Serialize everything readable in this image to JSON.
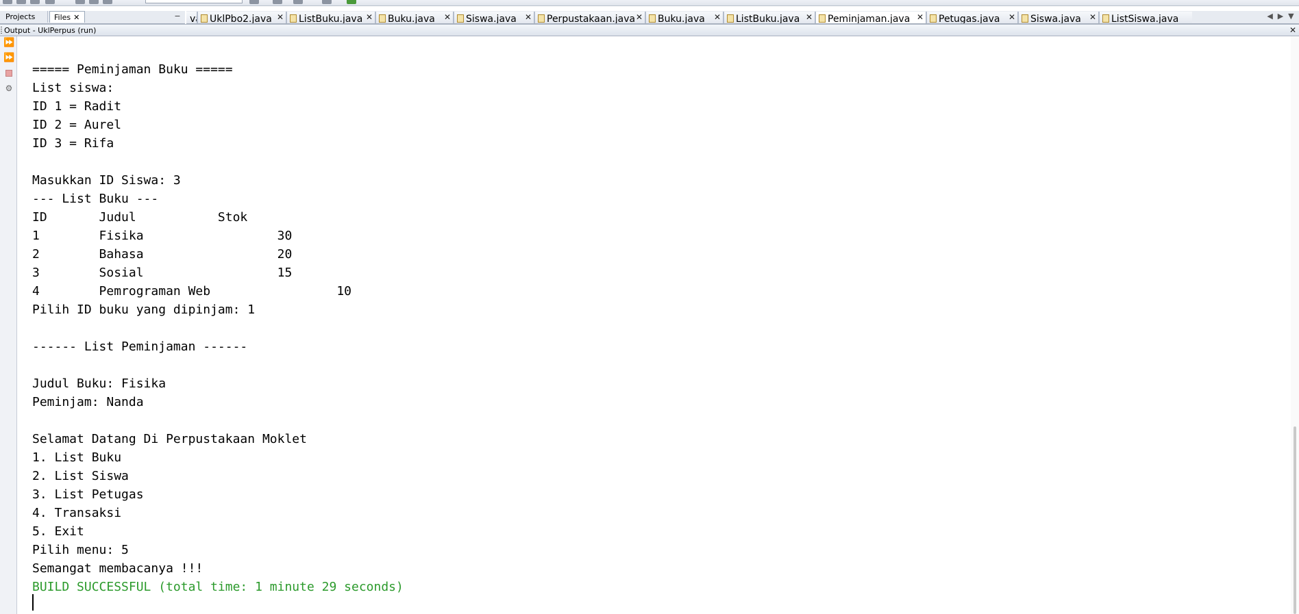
{
  "left_panel": {
    "tabs": [
      {
        "label": "Projects"
      },
      {
        "label": "Files",
        "close": "✕"
      }
    ],
    "minimize": "−"
  },
  "editor_tabs": [
    {
      "label": "va"
    },
    {
      "label": "UklPbo2.java"
    },
    {
      "label": "ListBuku.java"
    },
    {
      "label": "Buku.java"
    },
    {
      "label": "Siswa.java"
    },
    {
      "label": "Perpustakaan.java"
    },
    {
      "label": "Buku.java"
    },
    {
      "label": "ListBuku.java"
    },
    {
      "label": "Peminjaman.java"
    },
    {
      "label": "Petugas.java"
    },
    {
      "label": "Siswa.java"
    },
    {
      "label": "ListSiswa.java"
    }
  ],
  "output_panel": {
    "title": "Output - UklPerpus (run)",
    "close": "✕"
  },
  "side_actions": [
    {
      "name": "run-again-icon"
    },
    {
      "name": "rerun-with-params-icon"
    },
    {
      "name": "stop-icon"
    },
    {
      "name": "settings-icon"
    }
  ],
  "console": {
    "lines": [
      "===== Peminjaman Buku =====",
      "List siswa:",
      "ID 1 = Radit",
      "ID 2 = Aurel",
      "ID 3 = Rifa",
      "",
      "Masukkan ID Siswa: 3",
      "--- List Buku ---",
      "ID       Judul           Stok",
      "1        Fisika                  30",
      "2        Bahasa                  20",
      "3        Sosial                  15",
      "4        Pemrograman Web                 10",
      "Pilih ID buku yang dipinjam: 1",
      "",
      "------ List Peminjaman ------",
      "",
      "Judul Buku: Fisika",
      "Peminjam: Nanda",
      "",
      "Selamat Datang Di Perpustakaan Moklet",
      "1. List Buku",
      "2. List Siswa",
      "3. List Petugas",
      "4. Transaksi",
      "5. Exit",
      "Pilih menu: 5",
      "Semangat membacanya !!!"
    ],
    "build_status": "BUILD SUCCESSFUL (total time: 1 minute 29 seconds)"
  },
  "colors": {
    "success_text": "#2b9a2b",
    "panel_bg": "#e7ebf1"
  }
}
